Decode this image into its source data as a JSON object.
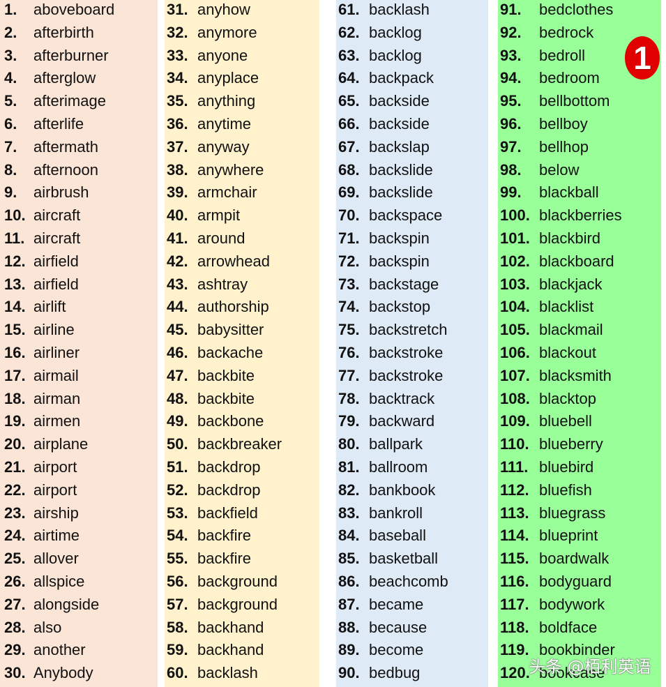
{
  "colors": {
    "col1": "#fbe5d6",
    "col2": "#fff2cc",
    "col3": "#deebf7",
    "col4": "#99ff99",
    "badge": "#e00000"
  },
  "badge": "1",
  "watermark": "头条 @栢利英语",
  "columns": [
    [
      {
        "n": "1.",
        "w": "aboveboard"
      },
      {
        "n": "2.",
        "w": "afterbirth"
      },
      {
        "n": "3.",
        "w": "afterburner"
      },
      {
        "n": "4.",
        "w": "afterglow"
      },
      {
        "n": "5.",
        "w": "afterimage"
      },
      {
        "n": "6.",
        "w": "afterlife"
      },
      {
        "n": "7.",
        "w": "aftermath"
      },
      {
        "n": "8.",
        "w": "afternoon"
      },
      {
        "n": "9.",
        "w": "airbrush"
      },
      {
        "n": "10.",
        "w": "aircraft"
      },
      {
        "n": "11.",
        "w": "aircraft"
      },
      {
        "n": "12.",
        "w": "airfield"
      },
      {
        "n": "13.",
        "w": "airfield"
      },
      {
        "n": "14.",
        "w": "airlift"
      },
      {
        "n": "15.",
        "w": "airline"
      },
      {
        "n": "16.",
        "w": "airliner"
      },
      {
        "n": "17.",
        "w": "airmail"
      },
      {
        "n": "18.",
        "w": "airman"
      },
      {
        "n": "19.",
        "w": "airmen"
      },
      {
        "n": "20.",
        "w": "airplane"
      },
      {
        "n": "21.",
        "w": "airport"
      },
      {
        "n": "22.",
        "w": "airport"
      },
      {
        "n": "23.",
        "w": "airship"
      },
      {
        "n": "24.",
        "w": "airtime"
      },
      {
        "n": "25.",
        "w": "allover"
      },
      {
        "n": "26.",
        "w": "allspice"
      },
      {
        "n": "27.",
        "w": "alongside"
      },
      {
        "n": "28.",
        "w": "also"
      },
      {
        "n": "29.",
        "w": "another"
      },
      {
        "n": "30.",
        "w": "Anybody"
      }
    ],
    [
      {
        "n": "31.",
        "w": "anyhow"
      },
      {
        "n": "32.",
        "w": "anymore"
      },
      {
        "n": "33.",
        "w": "anyone"
      },
      {
        "n": "34.",
        "w": "anyplace"
      },
      {
        "n": "35.",
        "w": "anything"
      },
      {
        "n": "36.",
        "w": "anytime"
      },
      {
        "n": "37.",
        "w": "anyway"
      },
      {
        "n": "38.",
        "w": "anywhere"
      },
      {
        "n": "39.",
        "w": "armchair"
      },
      {
        "n": "40.",
        "w": "armpit"
      },
      {
        "n": "41.",
        "w": "around"
      },
      {
        "n": "42.",
        "w": "arrowhead"
      },
      {
        "n": "43.",
        "w": "ashtray"
      },
      {
        "n": "44.",
        "w": "authorship"
      },
      {
        "n": "45.",
        "w": "babysitter"
      },
      {
        "n": "46.",
        "w": "backache"
      },
      {
        "n": "47.",
        "w": "backbite"
      },
      {
        "n": "48.",
        "w": "backbite"
      },
      {
        "n": "49.",
        "w": "backbone"
      },
      {
        "n": "50.",
        "w": "backbreaker"
      },
      {
        "n": "51.",
        "w": "backdrop"
      },
      {
        "n": "52.",
        "w": "backdrop"
      },
      {
        "n": "53.",
        "w": "backfield"
      },
      {
        "n": "54.",
        "w": "backfire"
      },
      {
        "n": "55.",
        "w": "backfire"
      },
      {
        "n": "56.",
        "w": "background"
      },
      {
        "n": "57.",
        "w": "background"
      },
      {
        "n": "58.",
        "w": "backhand"
      },
      {
        "n": "59.",
        "w": "backhand"
      },
      {
        "n": "60.",
        "w": "backlash"
      }
    ],
    [
      {
        "n": "61.",
        "w": "backlash"
      },
      {
        "n": "62.",
        "w": "backlog"
      },
      {
        "n": "63.",
        "w": "backlog"
      },
      {
        "n": "64.",
        "w": "backpack"
      },
      {
        "n": "65.",
        "w": "backside"
      },
      {
        "n": "66.",
        "w": "backside"
      },
      {
        "n": "67.",
        "w": "backslap"
      },
      {
        "n": "68.",
        "w": "backslide"
      },
      {
        "n": "69.",
        "w": "backslide"
      },
      {
        "n": "70.",
        "w": "backspace"
      },
      {
        "n": "71.",
        "w": "backspin"
      },
      {
        "n": "72.",
        "w": "backspin"
      },
      {
        "n": "73.",
        "w": "backstage"
      },
      {
        "n": "74.",
        "w": "backstop"
      },
      {
        "n": "75.",
        "w": "backstretch"
      },
      {
        "n": "76.",
        "w": "backstroke"
      },
      {
        "n": "77.",
        "w": "backstroke"
      },
      {
        "n": "78.",
        "w": "backtrack"
      },
      {
        "n": "79.",
        "w": "backward"
      },
      {
        "n": "80.",
        "w": "ballpark"
      },
      {
        "n": "81.",
        "w": "ballroom"
      },
      {
        "n": "82.",
        "w": "bankbook"
      },
      {
        "n": "83.",
        "w": "bankroll"
      },
      {
        "n": "84.",
        "w": "baseball"
      },
      {
        "n": "85.",
        "w": "basketball"
      },
      {
        "n": "86.",
        "w": "beachcomb"
      },
      {
        "n": "87.",
        "w": "became"
      },
      {
        "n": "88.",
        "w": "because"
      },
      {
        "n": "89.",
        "w": "become"
      },
      {
        "n": "90.",
        "w": "bedbug"
      }
    ],
    [
      {
        "n": "91.",
        "w": "bedclothes"
      },
      {
        "n": "92.",
        "w": "bedrock"
      },
      {
        "n": "93.",
        "w": "bedroll"
      },
      {
        "n": "94.",
        "w": "bedroom"
      },
      {
        "n": "95.",
        "w": "bellbottom"
      },
      {
        "n": "96.",
        "w": "bellboy"
      },
      {
        "n": "97.",
        "w": "bellhop"
      },
      {
        "n": "98.",
        "w": "below"
      },
      {
        "n": "99.",
        "w": "blackball"
      },
      {
        "n": "100.",
        "w": "blackberries"
      },
      {
        "n": "101.",
        "w": "blackbird"
      },
      {
        "n": "102.",
        "w": "blackboard"
      },
      {
        "n": "103.",
        "w": "blackjack"
      },
      {
        "n": "104.",
        "w": "blacklist"
      },
      {
        "n": "105.",
        "w": "blackmail"
      },
      {
        "n": "106.",
        "w": "blackout"
      },
      {
        "n": "107.",
        "w": "blacksmith"
      },
      {
        "n": "108.",
        "w": "blacktop"
      },
      {
        "n": "109.",
        "w": "bluebell"
      },
      {
        "n": "110.",
        "w": "blueberry"
      },
      {
        "n": "111.",
        "w": "bluebird"
      },
      {
        "n": "112.",
        "w": "bluefish"
      },
      {
        "n": "113.",
        "w": "bluegrass"
      },
      {
        "n": "114.",
        "w": "blueprint"
      },
      {
        "n": "115.",
        "w": "boardwalk"
      },
      {
        "n": "116.",
        "w": "bodyguard"
      },
      {
        "n": "117.",
        "w": "bodywork"
      },
      {
        "n": "118.",
        "w": "boldface"
      },
      {
        "n": "119.",
        "w": "bookbinder"
      },
      {
        "n": "120.",
        "w": "bookcase"
      }
    ]
  ]
}
